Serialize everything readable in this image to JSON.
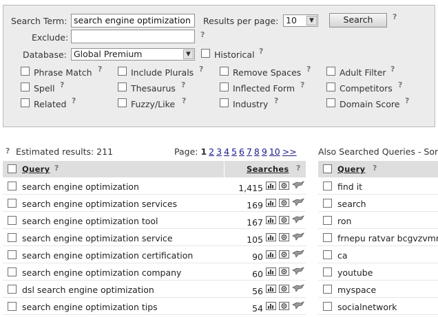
{
  "form": {
    "search_term_label": "Search Term:",
    "search_term_value": "search engine optimization",
    "results_per_page_label": "Results per page:",
    "results_per_page_value": "10",
    "search_button": "Search",
    "exclude_label": "Exclude:",
    "exclude_value": "",
    "database_label": "Database:",
    "database_value": "Global Premium",
    "historical_label": "Historical",
    "help_mark": "?",
    "options": [
      "Phrase Match",
      "Include Plurals",
      "Remove Spaces",
      "Adult Filter",
      "Spell",
      "Thesaurus",
      "Inflected Form",
      "Competitors",
      "Related",
      "Fuzzy/Like",
      "Industry",
      "Domain Score"
    ]
  },
  "results": {
    "estimated_label": "Estimated results: 211",
    "page_label": "Page:",
    "pages": [
      "1",
      "2",
      "3",
      "4",
      "5",
      "6",
      "7",
      "8",
      "9",
      "10",
      ">>"
    ],
    "current_page": "1",
    "header_query": "Query",
    "header_searches": "Searches",
    "rows": [
      {
        "query": "search engine optimization",
        "searches": "1,415"
      },
      {
        "query": "search engine optimization services",
        "searches": "169"
      },
      {
        "query": "search engine optimization tool",
        "searches": "167"
      },
      {
        "query": "search engine optimization service",
        "searches": "105"
      },
      {
        "query": "search engine optimization certification",
        "searches": "90"
      },
      {
        "query": "search engine optimization company",
        "searches": "60"
      },
      {
        "query": "dsl search engine optimization",
        "searches": "56"
      },
      {
        "query": "search engine optimization tips",
        "searches": "54"
      }
    ]
  },
  "also": {
    "title": "Also Searched Queries - Sor",
    "header_query": "Query",
    "rows": [
      "find it",
      "search",
      "ron",
      "frnepu ratvar bcgvzvmn",
      "ca",
      "youtube",
      "myspace",
      "socialnetwork"
    ]
  },
  "icons": [
    "help-icon",
    "bar-chart-icon",
    "view-icon",
    "bird-icon",
    "dropdown-arrow-icon"
  ]
}
